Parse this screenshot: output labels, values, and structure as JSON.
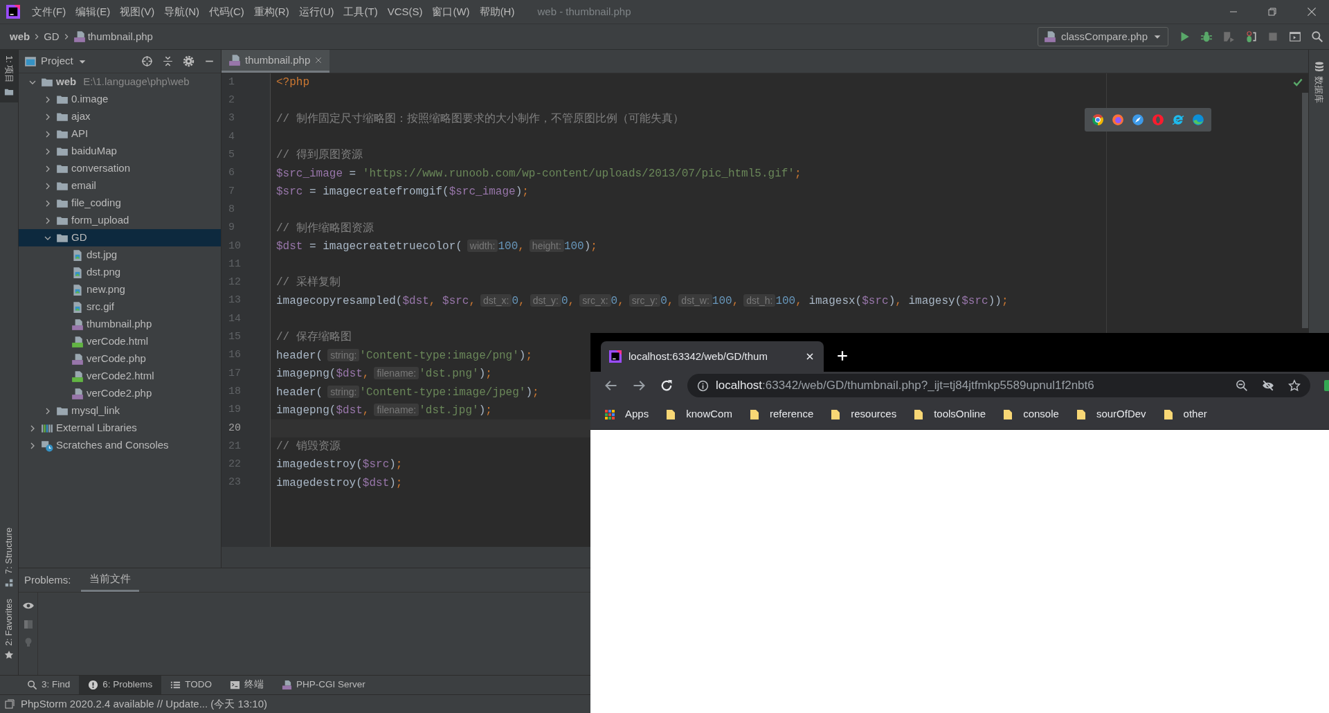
{
  "title_bar": {
    "menus": [
      "文件(F)",
      "编辑(E)",
      "视图(V)",
      "导航(N)",
      "代码(C)",
      "重构(R)",
      "运行(U)",
      "工具(T)",
      "VCS(S)",
      "窗口(W)",
      "帮助(H)"
    ],
    "title": "web - thumbnail.php"
  },
  "breadcrumb": [
    {
      "label": "web",
      "kind": "project"
    },
    {
      "label": "GD",
      "kind": "folder"
    },
    {
      "label": "thumbnail.php",
      "kind": "php"
    }
  ],
  "run_config": {
    "label": "classCompare.php"
  },
  "left_strip": [
    {
      "label": "1: 项目",
      "kind": "project",
      "selected": true
    },
    {
      "label": "7: Structure",
      "kind": "structure",
      "selected": false
    },
    {
      "label": "2: Favorites",
      "kind": "favorites",
      "selected": false
    }
  ],
  "right_strip": [
    {
      "label": "数据库",
      "selected": false
    }
  ],
  "project_panel": {
    "title": "Project",
    "tree": [
      {
        "label": "web",
        "kind": "project",
        "path": "E:\\1.language\\php\\web",
        "expanded": true,
        "selected": false,
        "children": [
          {
            "label": "0.image",
            "kind": "folder",
            "expanded": false,
            "selected": false
          },
          {
            "label": "ajax",
            "kind": "folder",
            "expanded": false,
            "selected": false
          },
          {
            "label": "API",
            "kind": "folder",
            "expanded": false,
            "selected": false
          },
          {
            "label": "baiduMap",
            "kind": "folder",
            "expanded": false,
            "selected": false
          },
          {
            "label": "conversation",
            "kind": "folder",
            "expanded": false,
            "selected": false
          },
          {
            "label": "email",
            "kind": "folder",
            "expanded": false,
            "selected": false
          },
          {
            "label": "file_coding",
            "kind": "folder",
            "expanded": false,
            "selected": false
          },
          {
            "label": "form_upload",
            "kind": "folder",
            "expanded": false,
            "selected": false
          },
          {
            "label": "GD",
            "kind": "folder",
            "expanded": true,
            "selected": true,
            "children": [
              {
                "label": "dst.jpg",
                "kind": "image",
                "selected": false
              },
              {
                "label": "dst.png",
                "kind": "image",
                "selected": false
              },
              {
                "label": "new.png",
                "kind": "image",
                "selected": false
              },
              {
                "label": "src.gif",
                "kind": "image",
                "selected": false
              },
              {
                "label": "thumbnail.php",
                "kind": "php",
                "selected": false
              },
              {
                "label": "verCode.html",
                "kind": "html",
                "selected": false
              },
              {
                "label": "verCode.php",
                "kind": "php",
                "selected": false
              },
              {
                "label": "verCode2.html",
                "kind": "html",
                "selected": false
              },
              {
                "label": "verCode2.php",
                "kind": "php",
                "selected": false
              }
            ]
          },
          {
            "label": "mysql_link",
            "kind": "folder",
            "expanded": false,
            "selected": false
          }
        ]
      },
      {
        "label": "External Libraries",
        "kind": "library",
        "expanded": false,
        "selected": false
      },
      {
        "label": "Scratches and Consoles",
        "kind": "scratches",
        "expanded": false,
        "selected": false
      }
    ]
  },
  "editor": {
    "tabs": [
      {
        "label": "thumbnail.php",
        "selected": true
      }
    ],
    "lines": [
      {
        "number": "1",
        "current": false,
        "tokens": [
          {
            "kind": "keyword",
            "text": "<?php"
          }
        ]
      },
      {
        "number": "2",
        "current": false
      },
      {
        "number": "3",
        "current": false,
        "tokens": [
          {
            "kind": "comment",
            "text": "// 制作固定尺寸缩略图：按照缩略图要求的大小制作，不管原图比例（可能失真）"
          }
        ]
      },
      {
        "number": "4",
        "current": false
      },
      {
        "number": "5",
        "current": false,
        "tokens": [
          {
            "kind": "comment",
            "text": "// 得到原图资源"
          }
        ]
      },
      {
        "number": "6",
        "current": false,
        "tokens": [
          {
            "kind": "var",
            "text": "$src_image"
          },
          {
            "kind": "plain",
            "text": " = "
          },
          {
            "kind": "string",
            "text": "'https://www.runoob.com/wp-content/uploads/2013/07/pic_html5.gif'"
          },
          {
            "kind": "op",
            "text": ";"
          }
        ]
      },
      {
        "number": "7",
        "current": false,
        "tokens": [
          {
            "kind": "var",
            "text": "$src"
          },
          {
            "kind": "plain",
            "text": " = imagecreatefromgif("
          },
          {
            "kind": "var",
            "text": "$src_image"
          },
          {
            "kind": "plain",
            "text": ")"
          },
          {
            "kind": "op",
            "text": ";"
          }
        ]
      },
      {
        "number": "8",
        "current": false
      },
      {
        "number": "9",
        "current": false,
        "tokens": [
          {
            "kind": "comment",
            "text": "// 制作缩略图资源"
          }
        ]
      },
      {
        "number": "10",
        "current": false,
        "tokens": [
          {
            "kind": "var",
            "text": "$dst"
          },
          {
            "kind": "plain",
            "text": " = imagecreatetruecolor("
          },
          {
            "kind": "hint",
            "text": "width:"
          },
          {
            "kind": "number",
            "text": "100"
          },
          {
            "kind": "op",
            "text": ","
          },
          {
            "kind": "hint",
            "text": "height:"
          },
          {
            "kind": "number",
            "text": "100"
          },
          {
            "kind": "plain",
            "text": ")"
          },
          {
            "kind": "op",
            "text": ";"
          }
        ]
      },
      {
        "number": "11",
        "current": false
      },
      {
        "number": "12",
        "current": false,
        "tokens": [
          {
            "kind": "comment",
            "text": "// 采样复制"
          }
        ]
      },
      {
        "number": "13",
        "current": false,
        "tokens": [
          {
            "kind": "plain",
            "text": "imagecopyresampled("
          },
          {
            "kind": "var",
            "text": "$dst"
          },
          {
            "kind": "op",
            "text": ", "
          },
          {
            "kind": "var",
            "text": "$src"
          },
          {
            "kind": "op",
            "text": ","
          },
          {
            "kind": "hint",
            "text": "dst_x:"
          },
          {
            "kind": "number",
            "text": "0"
          },
          {
            "kind": "op",
            "text": ","
          },
          {
            "kind": "hint",
            "text": "dst_y:"
          },
          {
            "kind": "number",
            "text": "0"
          },
          {
            "kind": "op",
            "text": ","
          },
          {
            "kind": "hint",
            "text": "src_x:"
          },
          {
            "kind": "number",
            "text": "0"
          },
          {
            "kind": "op",
            "text": ","
          },
          {
            "kind": "hint",
            "text": "src_y:"
          },
          {
            "kind": "number",
            "text": "0"
          },
          {
            "kind": "op",
            "text": ","
          },
          {
            "kind": "hint",
            "text": "dst_w:"
          },
          {
            "kind": "number",
            "text": "100"
          },
          {
            "kind": "op",
            "text": ","
          },
          {
            "kind": "hint",
            "text": "dst_h:"
          },
          {
            "kind": "number",
            "text": "100"
          },
          {
            "kind": "op",
            "text": ","
          },
          {
            "kind": "plain",
            "text": " imagesx("
          },
          {
            "kind": "var",
            "text": "$src"
          },
          {
            "kind": "plain",
            "text": ")"
          },
          {
            "kind": "op",
            "text": ","
          },
          {
            "kind": "plain",
            "text": " imagesy("
          },
          {
            "kind": "var",
            "text": "$src"
          },
          {
            "kind": "plain",
            "text": "))"
          },
          {
            "kind": "op",
            "text": ";"
          }
        ]
      },
      {
        "number": "14",
        "current": false
      },
      {
        "number": "15",
        "current": false,
        "tokens": [
          {
            "kind": "comment",
            "text": "// 保存缩略图"
          }
        ]
      },
      {
        "number": "16",
        "current": false,
        "tokens": [
          {
            "kind": "plain",
            "text": "header("
          },
          {
            "kind": "hint",
            "text": "string:"
          },
          {
            "kind": "string",
            "text": "'Content-type:image/png'"
          },
          {
            "kind": "plain",
            "text": ")"
          },
          {
            "kind": "op",
            "text": ";"
          }
        ]
      },
      {
        "number": "17",
        "current": false,
        "tokens": [
          {
            "kind": "plain",
            "text": "imagepng("
          },
          {
            "kind": "var",
            "text": "$dst"
          },
          {
            "kind": "op",
            "text": ","
          },
          {
            "kind": "hint",
            "text": "filename:"
          },
          {
            "kind": "string",
            "text": "'dst.png'"
          },
          {
            "kind": "plain",
            "text": ")"
          },
          {
            "kind": "op",
            "text": ";"
          }
        ]
      },
      {
        "number": "18",
        "current": false,
        "tokens": [
          {
            "kind": "plain",
            "text": "header("
          },
          {
            "kind": "hint",
            "text": "string:"
          },
          {
            "kind": "string",
            "text": "'Content-type:image/jpeg'"
          },
          {
            "kind": "plain",
            "text": ")"
          },
          {
            "kind": "op",
            "text": ";"
          }
        ]
      },
      {
        "number": "19",
        "current": false,
        "tokens": [
          {
            "kind": "plain",
            "text": "imagepng("
          },
          {
            "kind": "var",
            "text": "$dst"
          },
          {
            "kind": "op",
            "text": ","
          },
          {
            "kind": "hint",
            "text": "filename:"
          },
          {
            "kind": "string",
            "text": "'dst.jpg'"
          },
          {
            "kind": "plain",
            "text": ")"
          },
          {
            "kind": "op",
            "text": ";"
          }
        ]
      },
      {
        "number": "20",
        "current": true
      },
      {
        "number": "21",
        "current": false,
        "tokens": [
          {
            "kind": "comment",
            "text": "// 销毁资源"
          }
        ]
      },
      {
        "number": "22",
        "current": false,
        "tokens": [
          {
            "kind": "plain",
            "text": "imagedestroy("
          },
          {
            "kind": "var",
            "text": "$src"
          },
          {
            "kind": "plain",
            "text": ")"
          },
          {
            "kind": "op",
            "text": ";"
          }
        ]
      },
      {
        "number": "23",
        "current": false,
        "tokens": [
          {
            "kind": "plain",
            "text": "imagedestroy("
          },
          {
            "kind": "var",
            "text": "$dst"
          },
          {
            "kind": "plain",
            "text": ")"
          },
          {
            "kind": "op",
            "text": ";"
          }
        ]
      }
    ]
  },
  "problems": {
    "title": "Problems:",
    "tabs": [
      {
        "label": "当前文件",
        "selected": true
      }
    ]
  },
  "tool_tabs": [
    {
      "label": "3: Find",
      "kind": "find",
      "selected": false
    },
    {
      "label": "6: Problems",
      "kind": "problems",
      "selected": true
    },
    {
      "label": "TODO",
      "kind": "todo",
      "selected": false
    },
    {
      "label": "终端",
      "kind": "terminal",
      "selected": false
    },
    {
      "label": "PHP-CGI Server",
      "kind": "server",
      "selected": false
    }
  ],
  "status_bar": {
    "text": "PhpStorm 2020.2.4 available // Update... (今天 13:10)"
  },
  "browser": {
    "tabs": [
      {
        "title": "localhost:63342/web/GD/thum",
        "selected": true
      }
    ],
    "address": {
      "host": "localhost",
      "rest": ":63342/web/GD/thumbnail.php?_ijt=tj84jtfmkp5589upnul1f2nbt6"
    },
    "bookmarks": [
      {
        "label": "Apps",
        "kind": "apps"
      },
      {
        "label": "knowCom",
        "kind": "folder"
      },
      {
        "label": "reference",
        "kind": "folder"
      },
      {
        "label": "resources",
        "kind": "folder"
      },
      {
        "label": "toolsOnline",
        "kind": "folder"
      },
      {
        "label": "console",
        "kind": "folder"
      },
      {
        "label": "sourOfDev",
        "kind": "folder"
      },
      {
        "label": "other",
        "kind": "folder"
      }
    ]
  }
}
